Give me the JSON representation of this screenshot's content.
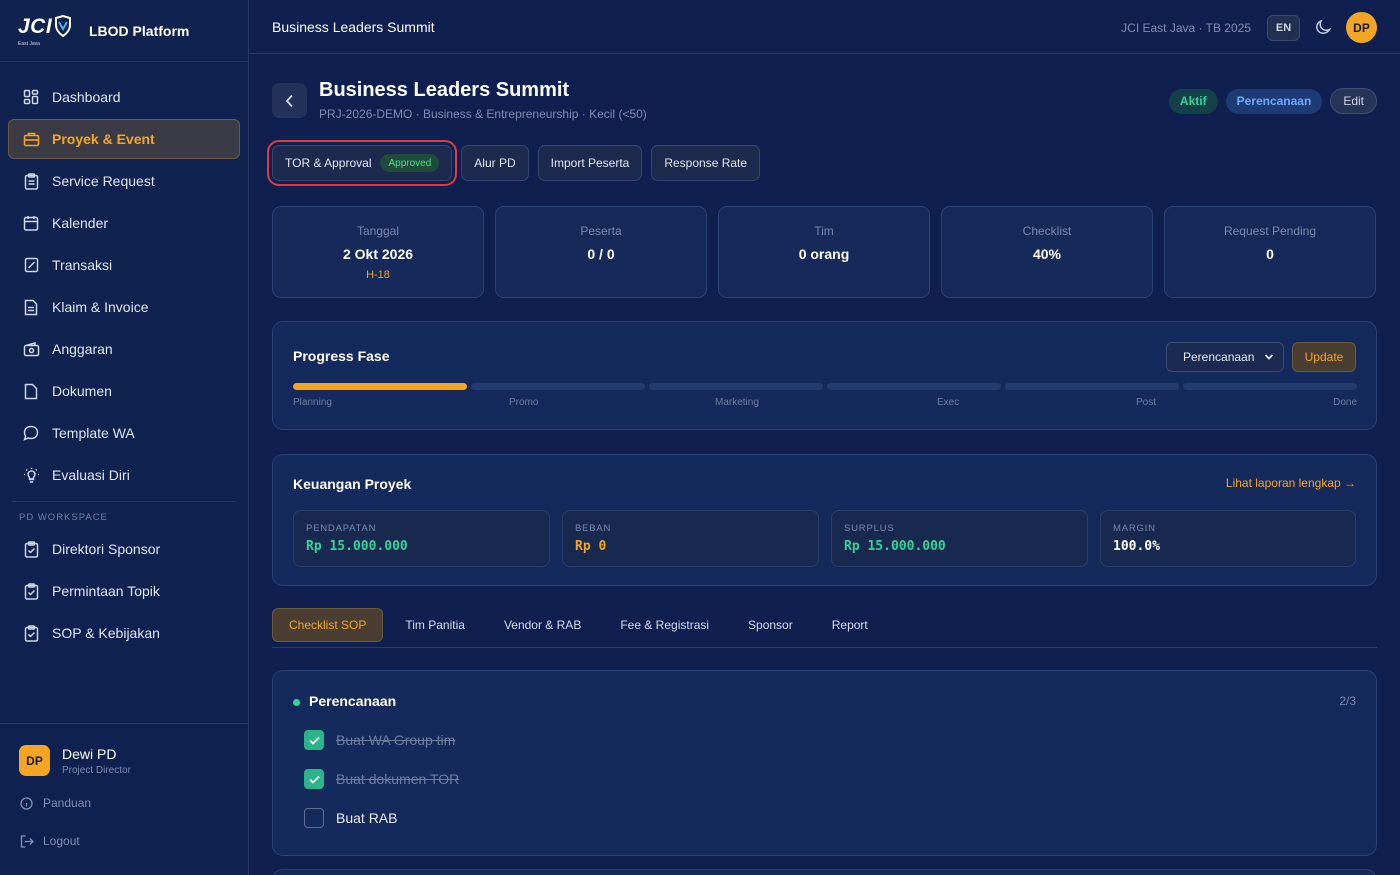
{
  "brand": {
    "logo_text": "JCI",
    "logo_sub": "East Java",
    "name": "LBOD Platform"
  },
  "sidebar": {
    "items": [
      {
        "label": "Dashboard",
        "icon": "grid-icon"
      },
      {
        "label": "Proyek & Event",
        "icon": "briefcase-icon",
        "active": true
      },
      {
        "label": "Service Request",
        "icon": "clipboard-icon"
      },
      {
        "label": "Kalender",
        "icon": "calendar-icon"
      },
      {
        "label": "Transaksi",
        "icon": "receipt-icon"
      },
      {
        "label": "Klaim & Invoice",
        "icon": "document-icon"
      },
      {
        "label": "Anggaran",
        "icon": "wallet-icon"
      },
      {
        "label": "Dokumen",
        "icon": "file-icon"
      },
      {
        "label": "Template WA",
        "icon": "chat-icon"
      },
      {
        "label": "Evaluasi Diri",
        "icon": "lightbulb-icon"
      }
    ],
    "section_label": "PD WORKSPACE",
    "workspace_items": [
      {
        "label": "Direktori Sponsor",
        "icon": "clipboard-icon"
      },
      {
        "label": "Permintaan Topik",
        "icon": "clipboard-icon"
      },
      {
        "label": "SOP & Kebijakan",
        "icon": "clipboard-icon"
      }
    ],
    "user": {
      "initials": "DP",
      "name": "Dewi PD",
      "role": "Project Director"
    },
    "help_label": "Panduan",
    "logout_label": "Logout"
  },
  "topbar": {
    "title": "Business Leaders Summit",
    "org": "JCI East Java · TB 2025",
    "lang": "EN",
    "avatar": "DP"
  },
  "project": {
    "title": "Business Leaders Summit",
    "subtitle": "PRJ-2026-DEMO · Business & Entrepreneurship · Kecil (<50)",
    "status_badge": "Aktif",
    "phase_badge": "Perencanaan",
    "edit_label": "Edit"
  },
  "subtabs": {
    "tor": "TOR & Approval",
    "tor_chip": "Approved",
    "alur": "Alur PD",
    "import": "Import Peserta",
    "response": "Response Rate"
  },
  "stats": [
    {
      "label": "Tanggal",
      "value": "2 Okt 2026",
      "sub": "H-18"
    },
    {
      "label": "Peserta",
      "value": "0 / 0"
    },
    {
      "label": "Tim",
      "value": "0 orang"
    },
    {
      "label": "Checklist",
      "value": "40%"
    },
    {
      "label": "Request Pending",
      "value": "0"
    }
  ],
  "progress": {
    "title": "Progress Fase",
    "select_value": "Perencanaan",
    "update_label": "Update",
    "phases": [
      "Planning",
      "Promo",
      "Marketing",
      "Exec",
      "Post",
      "Done"
    ],
    "completed_segments": 1,
    "total_segments": 6,
    "colors": {
      "done": "#f5a524",
      "pending": "#223a6e"
    }
  },
  "finance": {
    "title": "Keuangan Proyek",
    "link": "Lihat laporan lengkap →",
    "boxes": [
      {
        "label": "PENDAPATAN",
        "value": "Rp 15.000.000",
        "color": "green"
      },
      {
        "label": "BEBAN",
        "value": "Rp 0",
        "color": "orange"
      },
      {
        "label": "SURPLUS",
        "value": "Rp 15.000.000",
        "color": "green"
      },
      {
        "label": "MARGIN",
        "value": "100.0%",
        "color": "white"
      }
    ]
  },
  "tabs": [
    "Checklist SOP",
    "Tim Panitia",
    "Vendor & RAB",
    "Fee & Registrasi",
    "Sponsor",
    "Report"
  ],
  "checklist": {
    "title": "Perencanaan",
    "count": "2/3",
    "items": [
      {
        "label": "Buat WA Group tim",
        "done": true
      },
      {
        "label": "Buat dokumen TOR",
        "done": true
      },
      {
        "label": "Buat RAB",
        "done": false
      }
    ]
  }
}
